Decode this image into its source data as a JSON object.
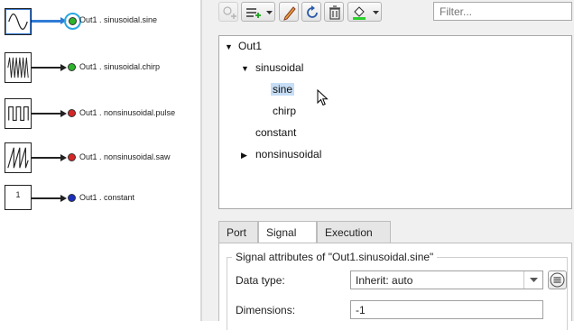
{
  "model": {
    "blocks": [
      {
        "kind": "sine",
        "signal": "Out1 . sinusoidal.sine",
        "color": "#2bb52b",
        "selected": true
      },
      {
        "kind": "chirp",
        "signal": "Out1 . sinusoidal.chirp",
        "color": "#2bb52b",
        "selected": false
      },
      {
        "kind": "pulse",
        "signal": "Out1 . nonsinusoidal.pulse",
        "color": "#d62626",
        "selected": false
      },
      {
        "kind": "saw",
        "signal": "Out1 . nonsinusoidal.saw",
        "color": "#d62626",
        "selected": false
      },
      {
        "kind": "constant",
        "value": "1",
        "signal": "Out1 . constant",
        "color": "#1a2fbf",
        "selected": false
      }
    ]
  },
  "toolbar": {
    "icons": [
      "add-signal-icon",
      "add-menu-icon",
      "pencil-icon",
      "refresh-icon",
      "delete-icon",
      "fill-color-icon"
    ],
    "filter_placeholder": "Filter..."
  },
  "tree": {
    "root": "Out1",
    "sinusoidal": "sinusoidal",
    "sine": "sine",
    "chirp": "chirp",
    "constant": "constant",
    "nonsinusoidal": "nonsinusoidal",
    "selected": "sine",
    "selection_color": "#c6ddf5"
  },
  "tabs": [
    "Port",
    "Signal",
    "Execution"
  ],
  "active_tab": "Signal",
  "attributes": {
    "title": "Signal attributes of \"Out1.sinusoidal.sine\"",
    "data_type_label": "Data type:",
    "data_type_value": "Inherit: auto",
    "dimensions_label": "Dimensions:",
    "dimensions_value": "-1"
  }
}
